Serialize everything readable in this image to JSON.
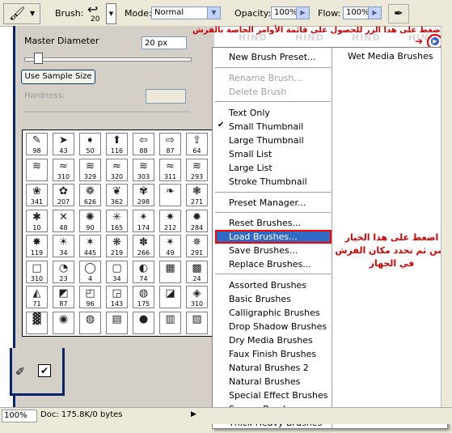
{
  "options_bar": {
    "brush_label": "Brush:",
    "brush_size": "20",
    "mode_label": "Mode:",
    "mode_value": "Normal",
    "opacity_label": "Opacity:",
    "opacity_value": "100%",
    "flow_label": "Flow:",
    "flow_value": "100%"
  },
  "brush_picker": {
    "master_diameter_label": "Master Diameter",
    "master_diameter_value": "20 px",
    "use_sample_size": "Use Sample Size",
    "hardness_label": "Hardness:",
    "brush_numbers": [
      [
        "98",
        "43",
        "50",
        "116",
        "88",
        "87",
        "64"
      ],
      [
        "",
        "310",
        "329",
        "320",
        "303",
        "311",
        "293"
      ],
      [
        "341",
        "207",
        "626",
        "362",
        "298",
        "",
        "271"
      ],
      [
        "10",
        "48",
        "90",
        "165",
        "174",
        "212",
        "284"
      ],
      [
        "119",
        "34",
        "445",
        "219",
        "266",
        "49",
        "291"
      ],
      [
        "310",
        "23",
        "4",
        "34",
        "74",
        "",
        "24"
      ],
      [
        "71",
        "87",
        "96",
        "143",
        "175",
        "",
        "310"
      ],
      [
        "",
        "",
        "",
        "",
        "",
        "",
        ""
      ]
    ],
    "brush_glyphs": [
      [
        "✎",
        "➤",
        "➧",
        "⬆",
        "⇦",
        "⇨",
        "⇪"
      ],
      [
        "≋",
        "≈",
        "≋",
        "≈",
        "≋",
        "≈",
        "≋"
      ],
      [
        "❀",
        "✿",
        "❁",
        "❦",
        "✾",
        "❧",
        "❃"
      ],
      [
        "✱",
        "✕",
        "✺",
        "✳",
        "✴",
        "✷",
        "✹"
      ],
      [
        "✸",
        "☀",
        "✶",
        "❋",
        "✽",
        "✴",
        "✵"
      ],
      [
        "□",
        "◔",
        "◯",
        "▢",
        "◐",
        "▦",
        "▩"
      ],
      [
        "◭",
        "◩",
        "◰",
        "◲",
        "◍",
        "◪",
        "◈"
      ],
      [
        "▓",
        "◉",
        "◍",
        "▤",
        "●",
        "▥",
        "▧"
      ]
    ]
  },
  "menu": {
    "items": [
      {
        "label": "New Brush Preset...",
        "disabled": false
      },
      {
        "label": "Rename Brush...",
        "disabled": true
      },
      {
        "label": "Delete Brush",
        "disabled": true
      },
      {
        "label": "Text Only",
        "disabled": false
      },
      {
        "label": "Small Thumbnail",
        "disabled": false,
        "checked": true
      },
      {
        "label": "Large Thumbnail",
        "disabled": false
      },
      {
        "label": "Small List",
        "disabled": false
      },
      {
        "label": "Large List",
        "disabled": false
      },
      {
        "label": "Stroke Thumbnail",
        "disabled": false
      },
      {
        "label": "Preset Manager...",
        "disabled": false
      },
      {
        "label": "Reset Brushes...",
        "disabled": false
      },
      {
        "label": "Load Brushes...",
        "disabled": false,
        "highlighted": true
      },
      {
        "label": "Save Brushes...",
        "disabled": false
      },
      {
        "label": "Replace Brushes...",
        "disabled": false
      },
      {
        "label": "Assorted Brushes",
        "disabled": false
      },
      {
        "label": "Basic Brushes",
        "disabled": false
      },
      {
        "label": "Calligraphic Brushes",
        "disabled": false
      },
      {
        "label": "Drop Shadow Brushes",
        "disabled": false
      },
      {
        "label": "Dry Media Brushes",
        "disabled": false
      },
      {
        "label": "Faux Finish Brushes",
        "disabled": false
      },
      {
        "label": "Natural Brushes 2",
        "disabled": false
      },
      {
        "label": "Natural Brushes",
        "disabled": false
      },
      {
        "label": "Special Effect Brushes",
        "disabled": false
      },
      {
        "label": "Square Brushes",
        "disabled": false
      },
      {
        "label": "Thick Heavy Brushes",
        "disabled": false
      }
    ],
    "right_column": "Wet Media Brushes",
    "checkmark": "✔"
  },
  "annotations": {
    "top": "اضغط على هذا الزر للحصول على قائمة الأوامر الخاصة بالفرش",
    "side_line1": "اضغط على هذا الخيار",
    "side_line2": "ومن ثم تحدد مكان الفرش",
    "side_line3": "في الجهاز"
  },
  "watermark": "HIND",
  "status": {
    "zoom": "100%",
    "doc": "Doc: 175.8K/0 bytes"
  },
  "colors": {
    "menu_highlight": "#316ac5",
    "annotation_red": "#d00000",
    "panel_border": "#0a246a"
  }
}
